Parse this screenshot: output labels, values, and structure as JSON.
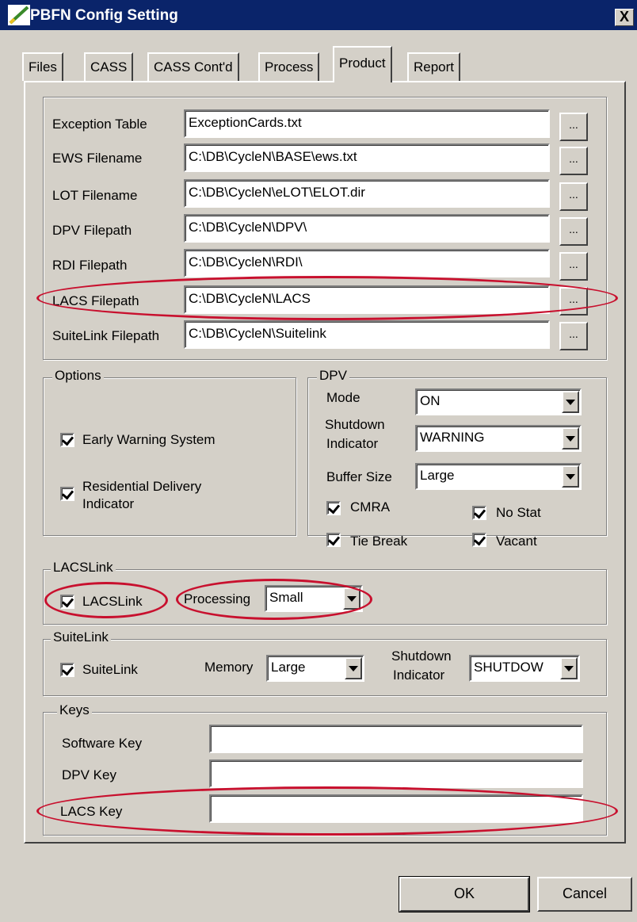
{
  "window": {
    "title": "PBFN Config Setting",
    "close_label": "X"
  },
  "tabs": [
    "Files",
    "CASS",
    "CASS Cont'd",
    "Process",
    "Product",
    "Report"
  ],
  "active_tab": "Product",
  "files": {
    "exception_table": {
      "label": "Exception Table",
      "value": "ExceptionCards.txt"
    },
    "ews_filename": {
      "label": "EWS Filename",
      "value": "C:\\DB\\CycleN\\BASE\\ews.txt"
    },
    "lot_filename": {
      "label": "LOT Filename",
      "value": "C:\\DB\\CycleN\\eLOT\\ELOT.dir"
    },
    "dpv_filepath": {
      "label": "DPV Filepath",
      "value": "C:\\DB\\CycleN\\DPV\\"
    },
    "rdi_filepath": {
      "label": "RDI Filepath",
      "value": "C:\\DB\\CycleN\\RDI\\"
    },
    "lacs_filepath": {
      "label": "LACS Filepath",
      "value": "C:\\DB\\CycleN\\LACS"
    },
    "suitelink_filepath": {
      "label": "SuiteLink Filepath",
      "value": "C:\\DB\\CycleN\\Suitelink"
    },
    "browse_label": "..."
  },
  "options": {
    "legend": "Options",
    "early_warning": {
      "label": "Early Warning System",
      "checked": true
    },
    "rdi_line1": "Residential Delivery",
    "rdi_line2": "Indicator",
    "rdi_checked": true
  },
  "dpv": {
    "legend": "DPV",
    "mode_label": "Mode",
    "mode_value": "ON",
    "shutdown_line1": "Shutdown",
    "shutdown_line2": "Indicator",
    "shutdown_value": "WARNING",
    "buffer_label": "Buffer Size",
    "buffer_value": "Large",
    "cmra": "CMRA",
    "no_stat": "No Stat",
    "tie_break": "Tie Break",
    "vacant": "Vacant"
  },
  "lacslink": {
    "legend": "LACSLink",
    "checkbox_label": "LACSLink",
    "processing_label": "Processing",
    "processing_value": "Small"
  },
  "suitelink": {
    "legend": "SuiteLink",
    "checkbox_label": "SuiteLink",
    "memory_label": "Memory",
    "memory_value": "Large",
    "shutdown_line1": "Shutdown",
    "shutdown_line2": "Indicator",
    "shutdown_value": "SHUTDOW"
  },
  "keys": {
    "legend": "Keys",
    "software_key": {
      "label": "Software Key",
      "value": ""
    },
    "dpv_key": {
      "label": "DPV Key",
      "value": ""
    },
    "lacs_key": {
      "label": "LACS Key",
      "value": ""
    }
  },
  "buttons": {
    "ok": "OK",
    "cancel": "Cancel"
  },
  "colors": {
    "titlebar": "#0a246a",
    "face": "#d4d0c8",
    "highlight_ring": "#c8102e"
  }
}
